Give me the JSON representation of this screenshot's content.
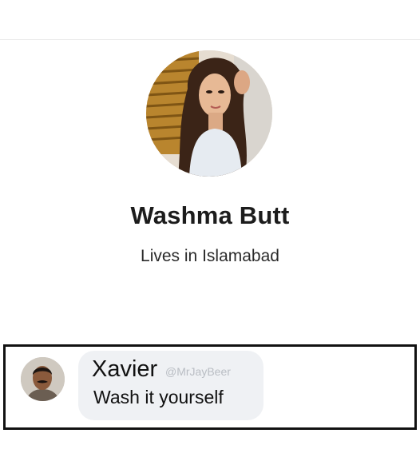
{
  "profile": {
    "name": "Washma Butt",
    "location": "Lives in Islamabad",
    "avatar_icon": "profile-photo"
  },
  "comment": {
    "author": "Xavier",
    "handle": "@MrJayBeer",
    "text": "Wash it yourself",
    "avatar_icon": "commenter-photo",
    "bubble_color": "#eff1f4",
    "frame_color": "#111111"
  }
}
